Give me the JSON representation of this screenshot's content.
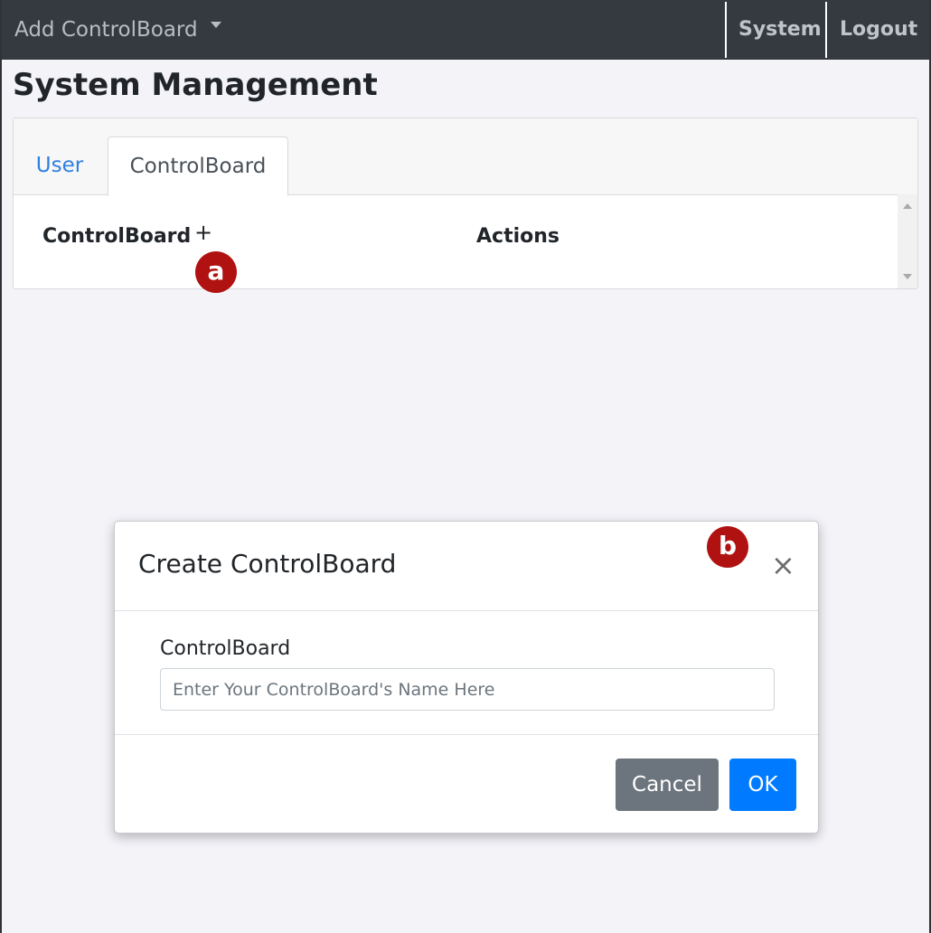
{
  "navbar": {
    "brand_label": "Add ControlBoard",
    "links": [
      {
        "label": "System"
      },
      {
        "label": "Logout"
      }
    ]
  },
  "page": {
    "title": "System Management"
  },
  "tabs": [
    {
      "label": "User",
      "active": false
    },
    {
      "label": "ControlBoard",
      "active": true
    }
  ],
  "table": {
    "columns": [
      "ControlBoard",
      "Actions"
    ],
    "add_symbol": "+"
  },
  "callouts": {
    "a": "a",
    "b": "b"
  },
  "modal": {
    "title": "Create ControlBoard",
    "close_symbol": "×",
    "field_label": "ControlBoard",
    "field_value": "",
    "field_placeholder": "Enter Your ControlBoard's Name Here",
    "cancel_label": "Cancel",
    "ok_label": "OK"
  },
  "colors": {
    "navbar_bg": "#343a40",
    "primary": "#007bff",
    "secondary": "#6c757d",
    "callout": "#b01212",
    "page_bg": "#f3f3f8"
  }
}
